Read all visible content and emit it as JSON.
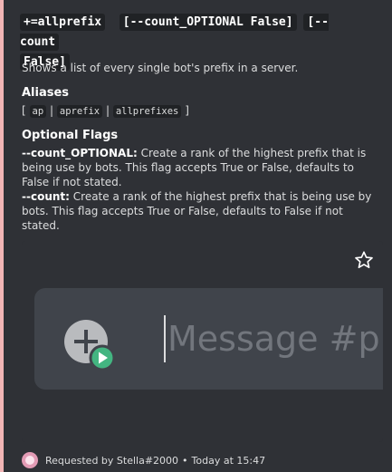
{
  "title": {
    "parts": [
      "+=allprefix",
      "[--count_OPTIONAL False]",
      "[--count",
      "False]"
    ]
  },
  "description": "Shows a list of every single bot's prefix in a server.",
  "aliases": {
    "heading": "Aliases",
    "open": "[",
    "close": "]",
    "sep": "|",
    "items": [
      "ap",
      "aprefix",
      "allprefixes"
    ]
  },
  "optional_flags": {
    "heading": "Optional Flags",
    "flags": [
      {
        "name": "--count_OPTIONAL:",
        "text": " Create a rank of the highest prefix that is being use by bots. This flag accepts True or False, defaults to False if not stated."
      },
      {
        "name": "--count:",
        "text": " Create a rank of the highest prefix that is being use by bots. This flag accepts True or False, defaults to False if not stated."
      }
    ]
  },
  "preview": {
    "placeholder": "Message #play",
    "star_icon": "star-outline-icon",
    "plus_icon": "add-attachment-icon",
    "play_badge_color": "#43b581"
  },
  "footer": {
    "requested_by": "Requested by Stella#2000",
    "separator": "•",
    "time": "Today at 15:47"
  },
  "colors": {
    "accent_bar": "#f1b5b5",
    "embed_bg": "#2f3136"
  }
}
